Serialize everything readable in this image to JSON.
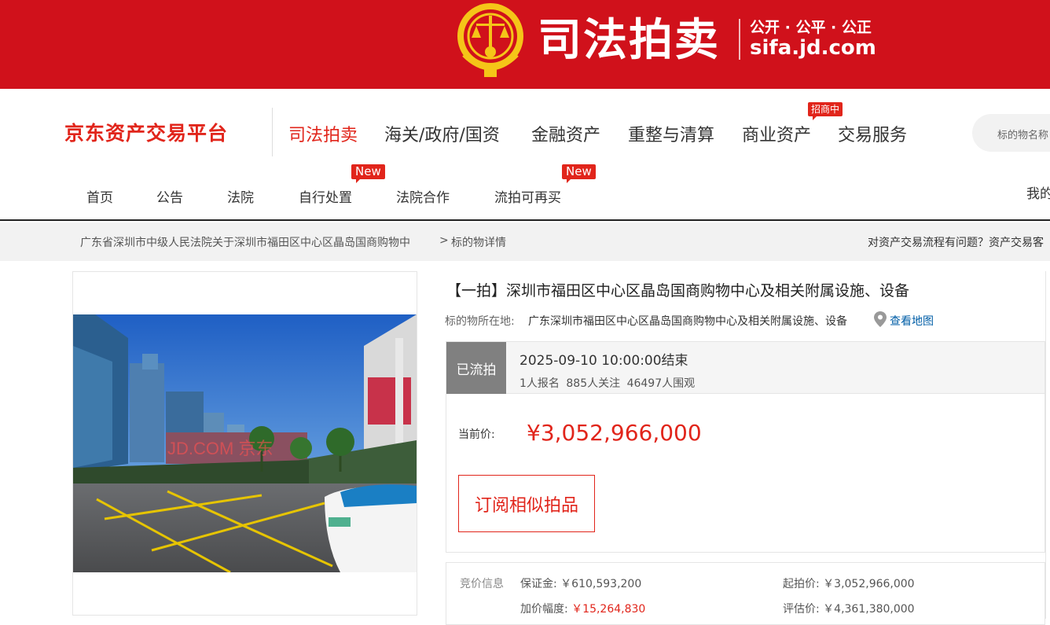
{
  "banner": {
    "title": "司法拍卖",
    "slogan": "公开 · 公平 · 公正",
    "url": "sifa.jd.com"
  },
  "header": {
    "logo": "京东资产交易平台",
    "main_nav": [
      {
        "label": "司法拍卖",
        "active": true
      },
      {
        "label": "海关/政府/国资"
      },
      {
        "label": "金融资产"
      },
      {
        "label": "重整与清算"
      },
      {
        "label": "商业资产",
        "badge": "招商中"
      },
      {
        "label": "交易服务"
      }
    ],
    "search_placeholder": "标的物名称",
    "sub_nav": [
      {
        "label": "首页"
      },
      {
        "label": "公告"
      },
      {
        "label": "法院"
      },
      {
        "label": "自行处置",
        "badge": "New"
      },
      {
        "label": "法院合作"
      },
      {
        "label": "流拍可再买",
        "badge": "New"
      }
    ],
    "mine": "我的"
  },
  "breadcrumb": {
    "parent": "广东省深圳市中级人民法院关于深圳市福田区中心区晶岛国商购物中",
    "separator": ">",
    "current": "标的物详情",
    "help": "对资产交易流程有问题？资产交易客"
  },
  "item": {
    "title": "【一拍】深圳市福田区中心区晶岛国商购物中心及相关附属设施、设备",
    "location_label": "标的物所在地:",
    "location": "广东深圳市福田区中心区晶岛国商购物中心及相关附属设施、设备",
    "map_link": "查看地图",
    "status": "已流拍",
    "end_time": "2025-09-10 10:00:00结束",
    "stats": {
      "signups": "1人报名",
      "follows": "885人关注",
      "viewers": "46497人围观"
    },
    "price_label": "当前价:",
    "price": "¥3,052,966,000",
    "subscribe": "订阅相似拍品",
    "watermark": "JD.COM 京东"
  },
  "bid_info": {
    "label": "竞价信息",
    "deposit_label": "保证金:",
    "deposit": "￥610,593,200",
    "start_label": "起拍价:",
    "start": "￥3,052,966,000",
    "increment_label": "加价幅度:",
    "increment": "￥15,264,830",
    "appraisal_label": "评估价:",
    "appraisal": "￥4,361,380,000"
  },
  "colors": {
    "brand_red": "#e1251b",
    "banner_red": "#d0111b",
    "status_gray": "#808080",
    "link_blue": "#005ea7"
  }
}
